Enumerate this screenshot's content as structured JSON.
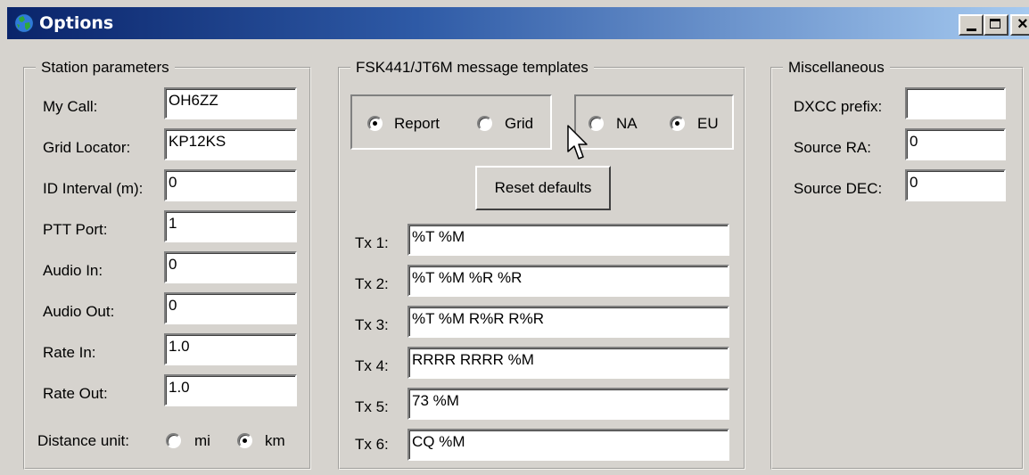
{
  "window": {
    "title": "Options",
    "minimize": "minimize",
    "maximize": "maximize",
    "close": "close"
  },
  "station": {
    "legend": "Station parameters",
    "fields": [
      {
        "label": "My Call:",
        "value": "OH6ZZ"
      },
      {
        "label": "Grid Locator:",
        "value": "KP12KS"
      },
      {
        "label": "ID Interval (m):",
        "value": "0"
      },
      {
        "label": "PTT Port:",
        "value": "1"
      },
      {
        "label": "Audio In:",
        "value": "0"
      },
      {
        "label": "Audio Out:",
        "value": "0"
      },
      {
        "label": "Rate In:",
        "value": "1.0"
      },
      {
        "label": "Rate Out:",
        "value": "1.0"
      }
    ],
    "distance_label": "Distance unit:",
    "distance_options": [
      {
        "label": "mi",
        "selected": false
      },
      {
        "label": "km",
        "selected": true
      }
    ]
  },
  "templates": {
    "legend": "FSK441/JT6M message templates",
    "report_grid": [
      {
        "label": "Report",
        "selected": true
      },
      {
        "label": "Grid",
        "selected": false
      }
    ],
    "region": [
      {
        "label": "NA",
        "selected": false
      },
      {
        "label": "EU",
        "selected": true
      }
    ],
    "reset_label": "Reset defaults",
    "tx": [
      {
        "label": "Tx 1:",
        "value": "%T %M"
      },
      {
        "label": "Tx 2:",
        "value": "%T %M %R %R"
      },
      {
        "label": "Tx 3:",
        "value": "%T %M R%R R%R"
      },
      {
        "label": "Tx 4:",
        "value": "RRRR RRRR %M"
      },
      {
        "label": "Tx 5:",
        "value": "73 %M"
      },
      {
        "label": "Tx 6:",
        "value": "CQ %M"
      }
    ]
  },
  "misc": {
    "legend": "Miscellaneous",
    "fields": [
      {
        "label": "DXCC prefix:",
        "value": ""
      },
      {
        "label": "Source RA:",
        "value": "0"
      },
      {
        "label": "Source DEC:",
        "value": "0"
      }
    ]
  },
  "icons": {
    "app": "globe-icon",
    "pointer": "mouse-pointer-icon"
  },
  "colors": {
    "titlebar_start": "#0a246a",
    "titlebar_end": "#a6caf0",
    "face": "#d6d3ce"
  }
}
